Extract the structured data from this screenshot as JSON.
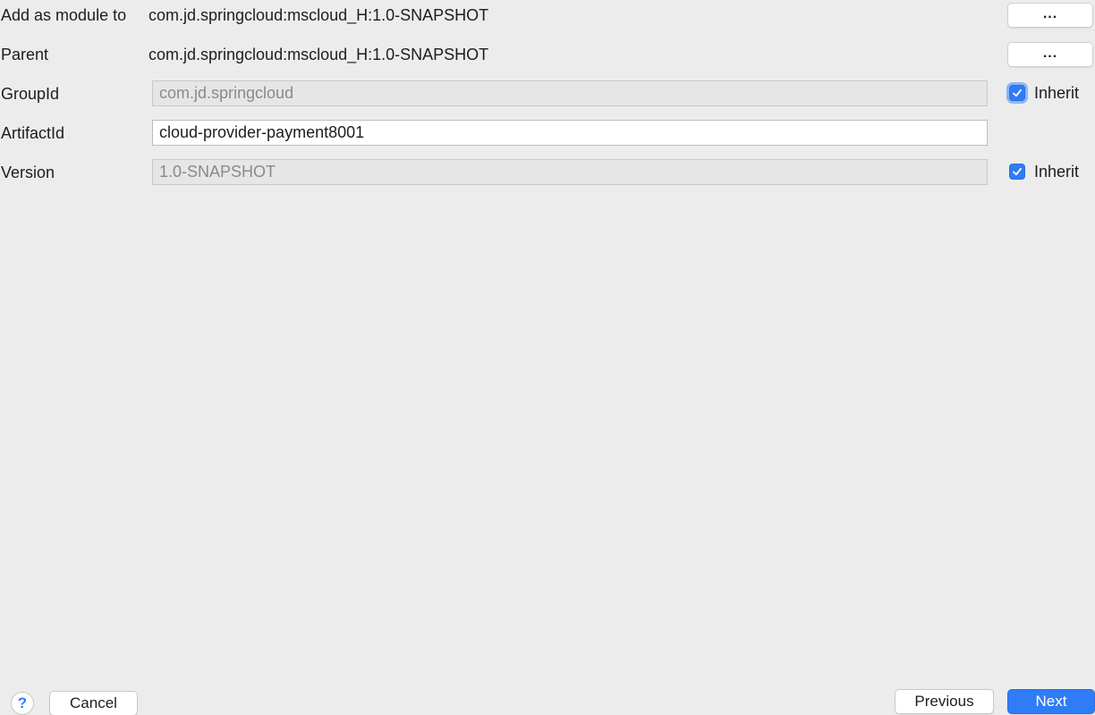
{
  "form": {
    "add_as_module": {
      "label": "Add as module to",
      "value": "com.jd.springcloud:mscloud_H:1.0-SNAPSHOT",
      "button": "..."
    },
    "parent": {
      "label": "Parent",
      "value": "com.jd.springcloud:mscloud_H:1.0-SNAPSHOT",
      "button": "..."
    },
    "group_id": {
      "label": "GroupId",
      "value": "com.jd.springcloud",
      "inherit_label": "Inherit",
      "inherit_checked": true
    },
    "artifact_id": {
      "label": "ArtifactId",
      "value": "cloud-provider-payment8001"
    },
    "version": {
      "label": "Version",
      "value": "1.0-SNAPSHOT",
      "inherit_label": "Inherit",
      "inherit_checked": true
    }
  },
  "footer": {
    "help_label": "?",
    "cancel_label": "Cancel",
    "previous_label": "Previous",
    "next_label": "Next"
  },
  "colors": {
    "background": "#ececec",
    "accent": "#2f7cf6",
    "disabled_field": "#e6e6e6"
  },
  "icons": {
    "checkbox": "check-icon",
    "help": "question-icon"
  }
}
